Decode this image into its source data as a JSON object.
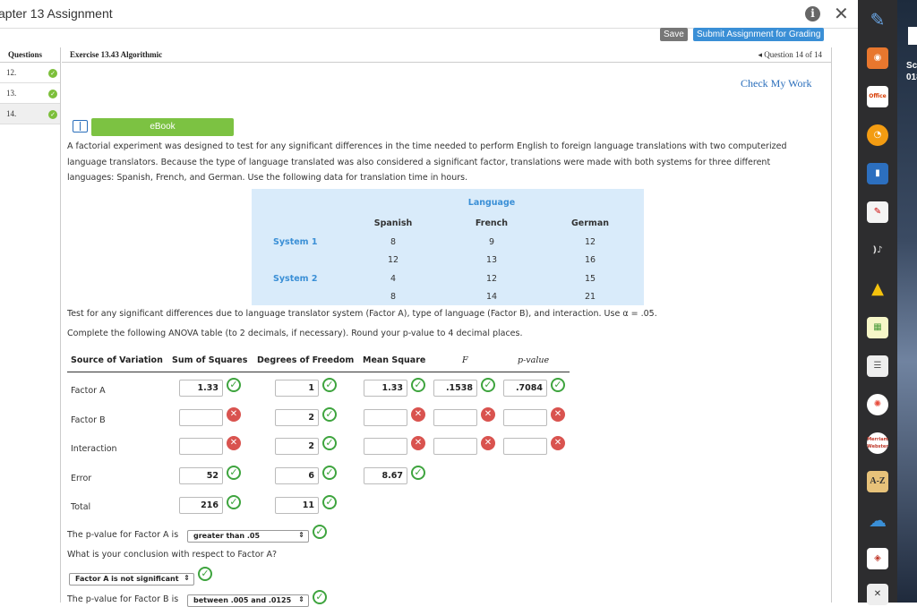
{
  "window": {
    "title": "apter 13 Assignment"
  },
  "toolbar": {
    "save_label": "Save",
    "submit_label": "Submit Assignment for Grading"
  },
  "questions_panel": {
    "header": "Questions",
    "items": [
      {
        "label": "12."
      },
      {
        "label": "13."
      },
      {
        "label": "14."
      }
    ]
  },
  "exercise": {
    "title": "Exercise 13.43 Algorithmic",
    "position": "◂ Question 14 of 14",
    "check_work": "Check My Work",
    "ebook": "eBook",
    "description": "A factorial experiment was designed to test for any significant differences in the time needed to perform English to foreign language translations with two computerized language translators. Because the type of language translated was also considered a significant factor, translations were made with both systems for three different languages: Spanish, French, and German. Use the following data for translation time in hours."
  },
  "data_table": {
    "language_header": "Language",
    "columns": [
      "Spanish",
      "French",
      "German"
    ],
    "rows": [
      {
        "system": "System 1",
        "values": [
          "8",
          "9",
          "12"
        ]
      },
      {
        "system": "",
        "values": [
          "12",
          "13",
          "16"
        ]
      },
      {
        "system": "System 2",
        "values": [
          "4",
          "12",
          "15"
        ]
      },
      {
        "system": "",
        "values": [
          "8",
          "14",
          "21"
        ]
      }
    ]
  },
  "instructions": {
    "test": "Test for any significant differences due to language translator system (Factor A), type of language (Factor B), and interaction. Use α = .05.",
    "complete": "Complete the following ANOVA table (to 2 decimals, if necessary). Round your p-value to 4 decimal places."
  },
  "anova": {
    "headers": [
      "Source of Variation",
      "Sum of Squares",
      "Degrees of Freedom",
      "Mean Square",
      "F",
      "p-value"
    ],
    "rows": [
      {
        "source": "Factor A",
        "ss": "1.33",
        "df": "1",
        "ms": "1.33",
        "f": ".1538",
        "p": ".7084"
      },
      {
        "source": "Factor B",
        "ss": "",
        "df": "2",
        "ms": "",
        "f": "",
        "p": ""
      },
      {
        "source": "Interaction",
        "ss": "",
        "df": "2",
        "ms": "",
        "f": "",
        "p": ""
      },
      {
        "source": "Error",
        "ss": "52",
        "df": "6",
        "ms": "8.67",
        "f": "",
        "p": ""
      },
      {
        "source": "Total",
        "ss": "216",
        "df": "11",
        "ms": "",
        "f": "",
        "p": ""
      }
    ]
  },
  "followup": {
    "p_factor_a_label": "The p-value for Factor A is",
    "p_factor_a_value": "greater than .05",
    "conclusion_question": "What is your conclusion with respect to Factor A?",
    "conclusion_value": "Factor A is not significant",
    "p_factor_b_label": "The p-value for Factor B is",
    "p_factor_b_value": "between .005 and .0125"
  },
  "desktop": {
    "text1": "Sc",
    "text2": "018"
  },
  "dock": {
    "office": "Office",
    "az": "A-Z",
    "merriam": "Merriam Webster"
  }
}
